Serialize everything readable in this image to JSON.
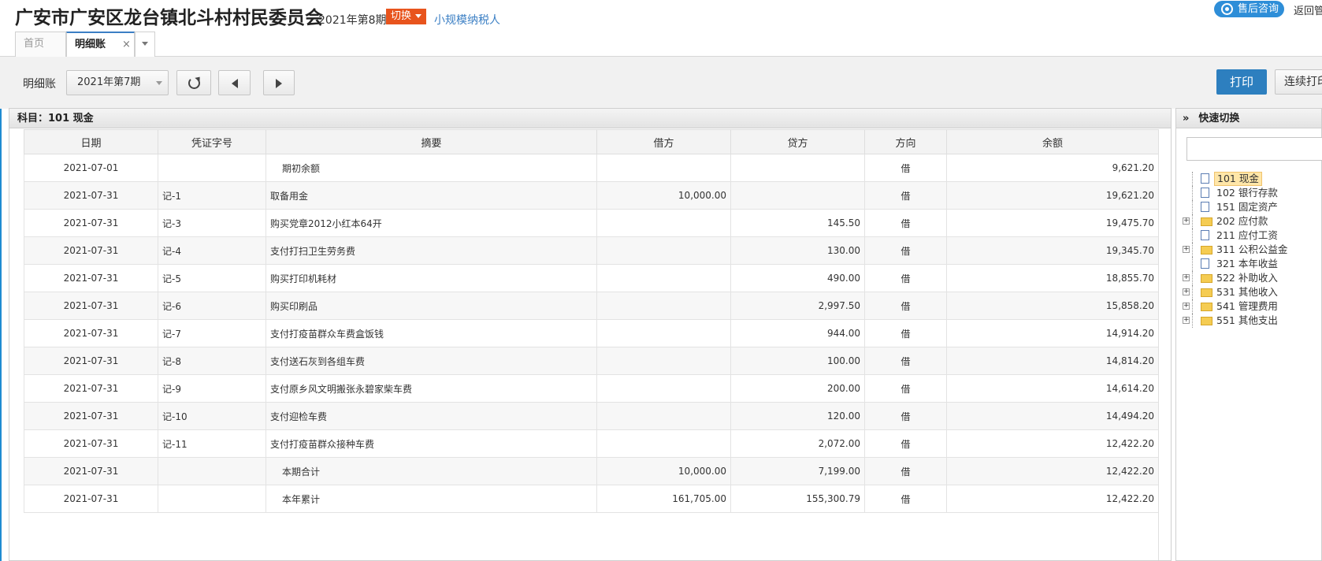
{
  "header": {
    "title": "广安市广安区龙台镇北斗村村民委员会",
    "period": "2021年第8期",
    "switch_label": "切换",
    "taxpayer": "小规模纳税人",
    "consult": "售后咨询",
    "back": "返回管"
  },
  "tabs": [
    {
      "label": "首页"
    },
    {
      "label": "明细账",
      "close": "×"
    }
  ],
  "toolbar": {
    "label": "明细账",
    "period_select": "2021年第7期",
    "print": "打印",
    "continuous_print": "连续打印"
  },
  "ledger": {
    "subject": "科目：101  现金",
    "columns": [
      "日期",
      "凭证字号",
      "摘要",
      "借方",
      "贷方",
      "方向",
      "余额"
    ],
    "rows": [
      {
        "date": "2021-07-01",
        "voucher": "",
        "summary": "期初余额",
        "debit": "",
        "credit": "",
        "dir": "借",
        "balance": "9,621.20"
      },
      {
        "date": "2021-07-31",
        "voucher": "记-1",
        "summary": "取备用金",
        "debit": "10,000.00",
        "credit": "",
        "dir": "借",
        "balance": "19,621.20"
      },
      {
        "date": "2021-07-31",
        "voucher": "记-3",
        "summary": "购买党章2012小红本64开",
        "debit": "",
        "credit": "145.50",
        "dir": "借",
        "balance": "19,475.70"
      },
      {
        "date": "2021-07-31",
        "voucher": "记-4",
        "summary": "支付打扫卫生劳务费",
        "debit": "",
        "credit": "130.00",
        "dir": "借",
        "balance": "19,345.70"
      },
      {
        "date": "2021-07-31",
        "voucher": "记-5",
        "summary": "购买打印机耗材",
        "debit": "",
        "credit": "490.00",
        "dir": "借",
        "balance": "18,855.70"
      },
      {
        "date": "2021-07-31",
        "voucher": "记-6",
        "summary": "购买印刷品",
        "debit": "",
        "credit": "2,997.50",
        "dir": "借",
        "balance": "15,858.20"
      },
      {
        "date": "2021-07-31",
        "voucher": "记-7",
        "summary": "支付打疫苗群众车费盒饭钱",
        "debit": "",
        "credit": "944.00",
        "dir": "借",
        "balance": "14,914.20"
      },
      {
        "date": "2021-07-31",
        "voucher": "记-8",
        "summary": "支付送石灰到各组车费",
        "debit": "",
        "credit": "100.00",
        "dir": "借",
        "balance": "14,814.20"
      },
      {
        "date": "2021-07-31",
        "voucher": "记-9",
        "summary": "支付原乡风文明搬张永碧家柴车费",
        "debit": "",
        "credit": "200.00",
        "dir": "借",
        "balance": "14,614.20"
      },
      {
        "date": "2021-07-31",
        "voucher": "记-10",
        "summary": "支付迎检车费",
        "debit": "",
        "credit": "120.00",
        "dir": "借",
        "balance": "14,494.20"
      },
      {
        "date": "2021-07-31",
        "voucher": "记-11",
        "summary": "支付打疫苗群众接种车费",
        "debit": "",
        "credit": "2,072.00",
        "dir": "借",
        "balance": "12,422.20"
      },
      {
        "date": "2021-07-31",
        "voucher": "",
        "summary": "本期合计",
        "debit": "10,000.00",
        "credit": "7,199.00",
        "dir": "借",
        "balance": "12,422.20"
      },
      {
        "date": "2021-07-31",
        "voucher": "",
        "summary": "本年累计",
        "debit": "161,705.00",
        "credit": "155,300.79",
        "dir": "借",
        "balance": "12,422.20"
      }
    ]
  },
  "quick": {
    "title": "快速切换",
    "accounts": [
      {
        "label": "101 现金",
        "type": "file",
        "selected": true
      },
      {
        "label": "102 银行存款",
        "type": "file"
      },
      {
        "label": "151 固定资产",
        "type": "file"
      },
      {
        "label": "202 应付款",
        "type": "folder"
      },
      {
        "label": "211 应付工资",
        "type": "file"
      },
      {
        "label": "311 公积公益金",
        "type": "folder"
      },
      {
        "label": "321 本年收益",
        "type": "file"
      },
      {
        "label": "522 补助收入",
        "type": "folder"
      },
      {
        "label": "531 其他收入",
        "type": "folder"
      },
      {
        "label": "541 管理费用",
        "type": "folder"
      },
      {
        "label": "551 其他支出",
        "type": "folder"
      }
    ]
  }
}
